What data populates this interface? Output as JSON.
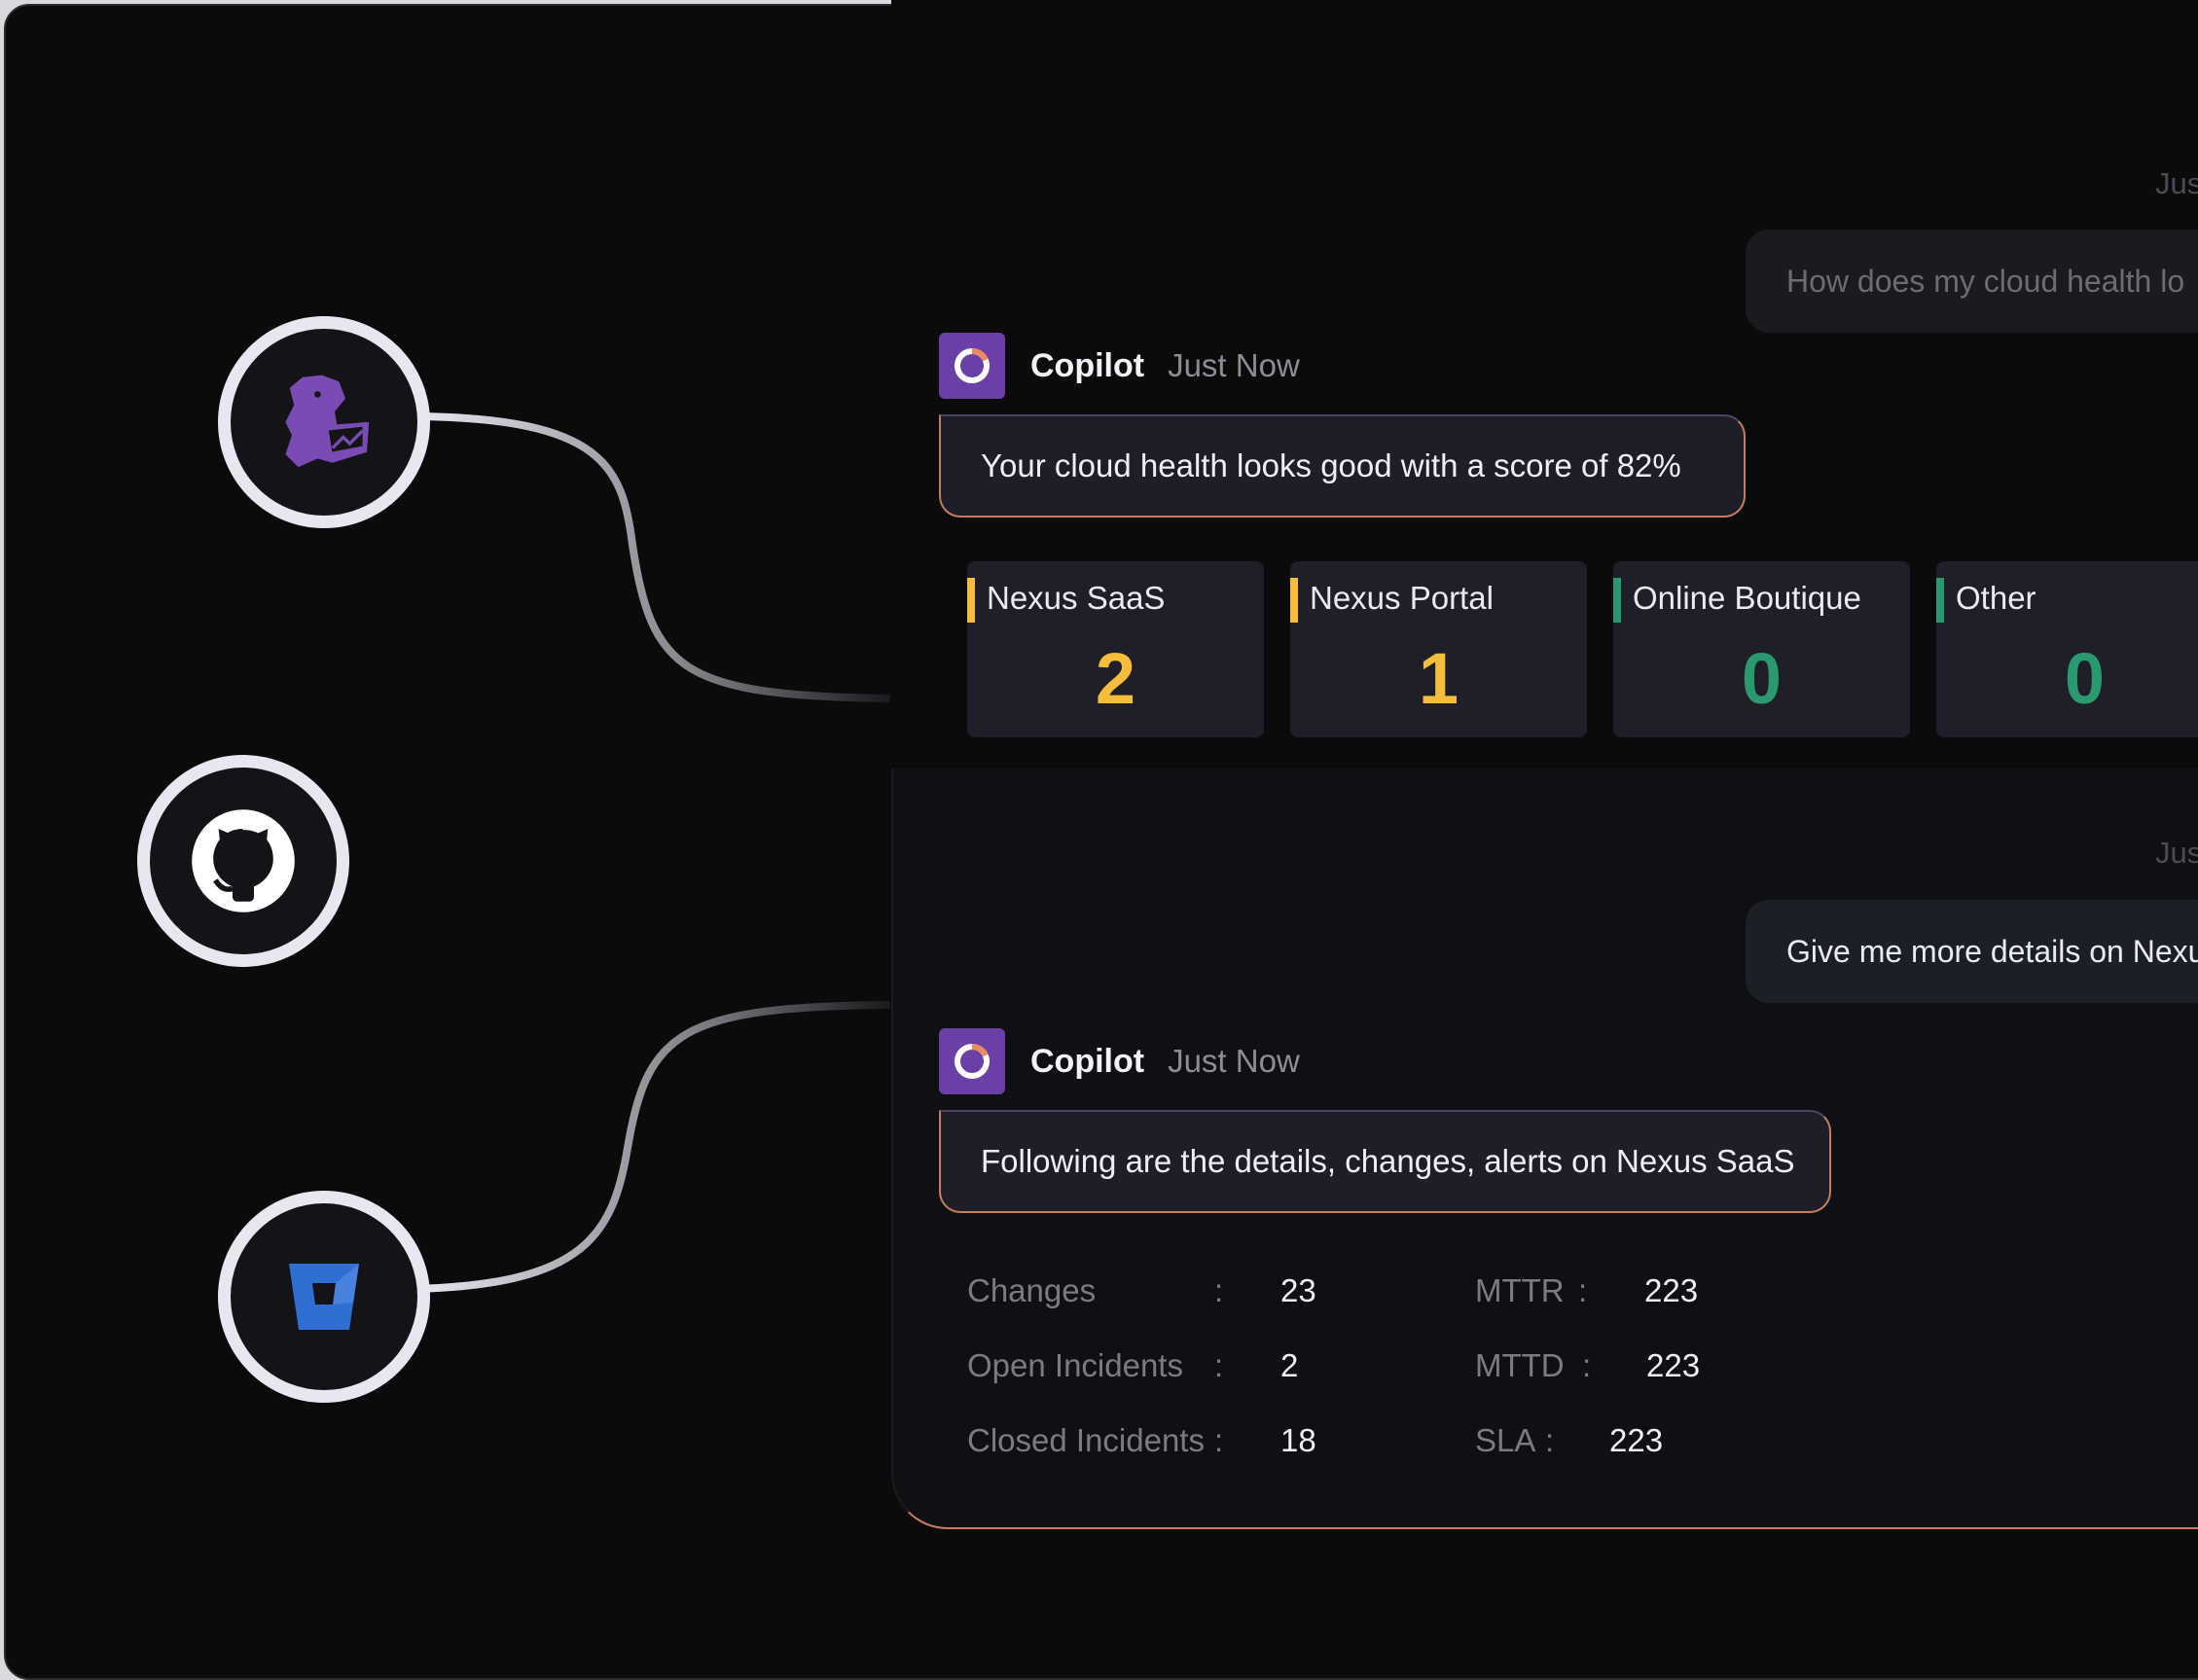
{
  "integrations": [
    {
      "name": "Datadog",
      "icon": "datadog-icon"
    },
    {
      "name": "GitHub",
      "icon": "github-icon"
    },
    {
      "name": "Bitbucket",
      "icon": "bitbucket-icon"
    }
  ],
  "chat": {
    "messages": [
      {
        "type": "user",
        "time": "Jus",
        "text": "How does my cloud health lo"
      },
      {
        "type": "bot",
        "sender": "Copilot",
        "time": "Just Now",
        "text": "Your cloud health looks good with a score of 82%"
      },
      {
        "type": "user",
        "time": "Jus",
        "text": "Give me more details on Nexu"
      },
      {
        "type": "bot",
        "sender": "Copilot",
        "time": "Just Now",
        "text": "Following are the details, changes, alerts on Nexus SaaS"
      }
    ],
    "health_cards": [
      {
        "name": "Nexus SaaS",
        "value": "2",
        "color": "#f6bd3c"
      },
      {
        "name": "Nexus Portal",
        "value": "1",
        "color": "#f6bd3c"
      },
      {
        "name": "Online Boutique",
        "value": "0",
        "color": "#2a9a6e"
      },
      {
        "name": "Other",
        "value": "0",
        "color": "#2a9a6e"
      }
    ],
    "details": {
      "left": [
        {
          "label": "Changes",
          "value": "23"
        },
        {
          "label": "Open Incidents",
          "value": "2"
        },
        {
          "label": "Closed Incidents",
          "value": "18"
        }
      ],
      "right": [
        {
          "label": "MTTR",
          "value": "223"
        },
        {
          "label": "MTTD",
          "value": "223"
        },
        {
          "label": "SLA",
          "value": "223"
        }
      ]
    },
    "separator": ":"
  },
  "colors": {
    "accent_border": "#c97c5d",
    "copilot_avatar": "#6a3fa6",
    "warning": "#f6bd3c",
    "ok": "#2a9a6e"
  }
}
